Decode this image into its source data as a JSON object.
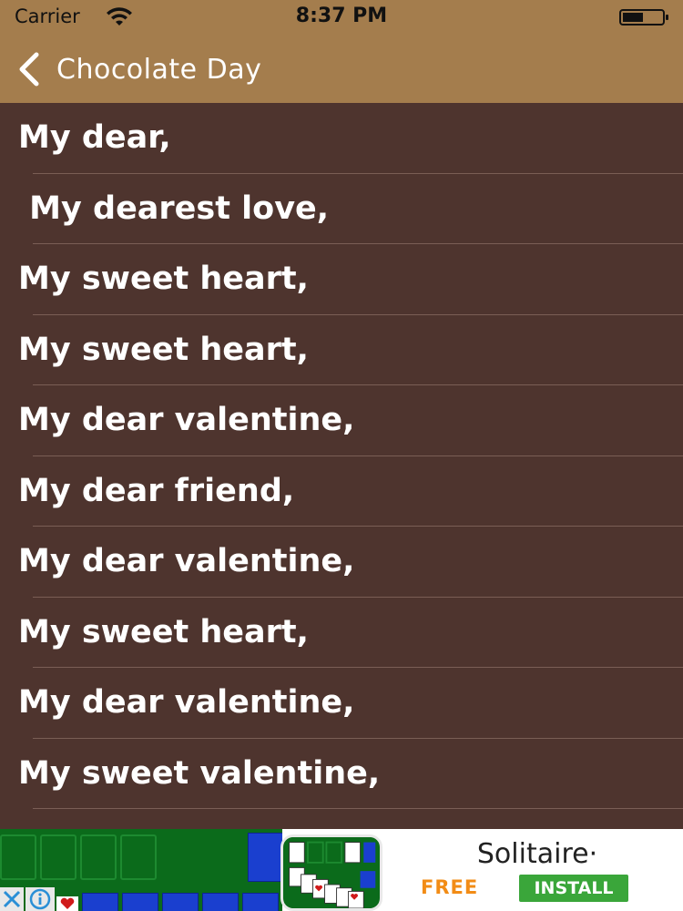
{
  "status_bar": {
    "carrier": "Carrier",
    "time": "8:37 PM",
    "wifi_icon": "wifi-icon",
    "battery_icon": "battery-icon"
  },
  "nav": {
    "back_icon": "chevron-left-icon",
    "title": "Chocolate Day"
  },
  "list": {
    "items": [
      {
        "label": "My dear,"
      },
      {
        "label": " My dearest love,"
      },
      {
        "label": "My sweet heart,"
      },
      {
        "label": "My sweet heart,"
      },
      {
        "label": "My dear valentine,"
      },
      {
        "label": "My dear friend,"
      },
      {
        "label": "My dear valentine,"
      },
      {
        "label": "My sweet heart,"
      },
      {
        "label": "My dear valentine,"
      },
      {
        "label": "My sweet valentine,"
      }
    ]
  },
  "ad": {
    "title": "Solitaire·",
    "free_label": "FREE",
    "install_label": "INSTALL",
    "close_icon": "close-icon",
    "info_icon": "info-icon"
  },
  "colors": {
    "header_bg": "#a47d4d",
    "list_bg": "#4e342e",
    "text": "#ffffff",
    "install_button": "#3aa63a",
    "free_text": "#f28c16"
  }
}
